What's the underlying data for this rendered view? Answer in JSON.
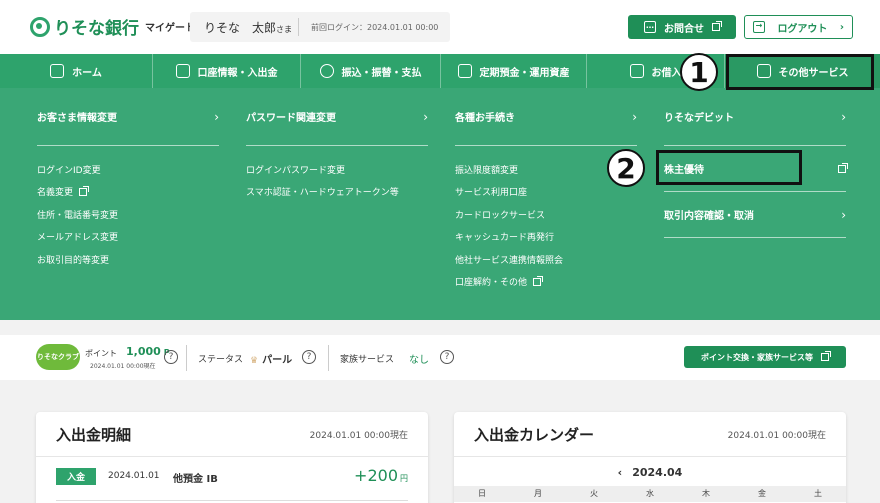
{
  "header": {
    "logo_text": "りそな銀行",
    "logo_sub": "マイゲート",
    "user_name": "りそな　太郎",
    "user_suffix": "さま",
    "last_login": "前回ログイン：2024.01.01 00:00",
    "contact_label": "お問合せ",
    "logout_label": "ログアウト"
  },
  "nav": {
    "items": [
      {
        "label": "ホーム",
        "icon": "home-icon"
      },
      {
        "label": "口座情報・入出金",
        "icon": "bank-icon"
      },
      {
        "label": "振込・振替・支払",
        "icon": "transfer-icon"
      },
      {
        "label": "定期預金・運用資産",
        "icon": "piggy-bank-icon"
      },
      {
        "label": "お借入",
        "icon": "loan-icon"
      },
      {
        "label": "その他サービス",
        "icon": "document-icon"
      }
    ]
  },
  "menu": {
    "col1": {
      "heading": "お客さま情報変更",
      "links": [
        "ログインID変更",
        "名義変更",
        "住所・電話番号変更",
        "メールアドレス変更",
        "お取引目的等変更"
      ]
    },
    "col2": {
      "heading": "パスワード関連変更",
      "links": [
        "ログインパスワード変更",
        "スマホ認証・ハードウェアトークン等"
      ]
    },
    "col3": {
      "heading": "各種お手続き",
      "links": [
        "振込限度額変更",
        "サービス利用口座",
        "カードロックサービス",
        "キャッシュカード再発行",
        "他社サービス連携情報照会",
        "口座解約・その他"
      ]
    },
    "col4": {
      "items": [
        "りそなデビット",
        "株主優待",
        "取引内容確認・取消"
      ]
    }
  },
  "annotations": {
    "one": "1",
    "two": "2"
  },
  "points": {
    "club_label": "りそなクラブ",
    "point_label": "ポイント",
    "point_value": "1,000",
    "point_unit": "P",
    "point_date": "2024.01.01 00:00現在",
    "status_label": "ステータス",
    "status_value": "パール",
    "family_label": "家族サービス",
    "family_value": "なし",
    "exchange_button": "ポイント交換・家族サービス等"
  },
  "transactions": {
    "title": "入出金明細",
    "date": "2024.01.01 00:00現在",
    "row": {
      "badge": "入金",
      "date": "2024.01.01",
      "desc": "他預金 IB",
      "amount": "+200",
      "unit": "円"
    }
  },
  "calendar": {
    "title": "入出金カレンダー",
    "date": "2024.01.01 00:00現在",
    "month": "2024.04",
    "weekdays": [
      "日",
      "月",
      "火",
      "水",
      "木",
      "金",
      "土"
    ]
  },
  "colors": {
    "brand_green": "#2ea36c",
    "dark_green": "#1f8f57",
    "menu_green": "#3aa776"
  }
}
